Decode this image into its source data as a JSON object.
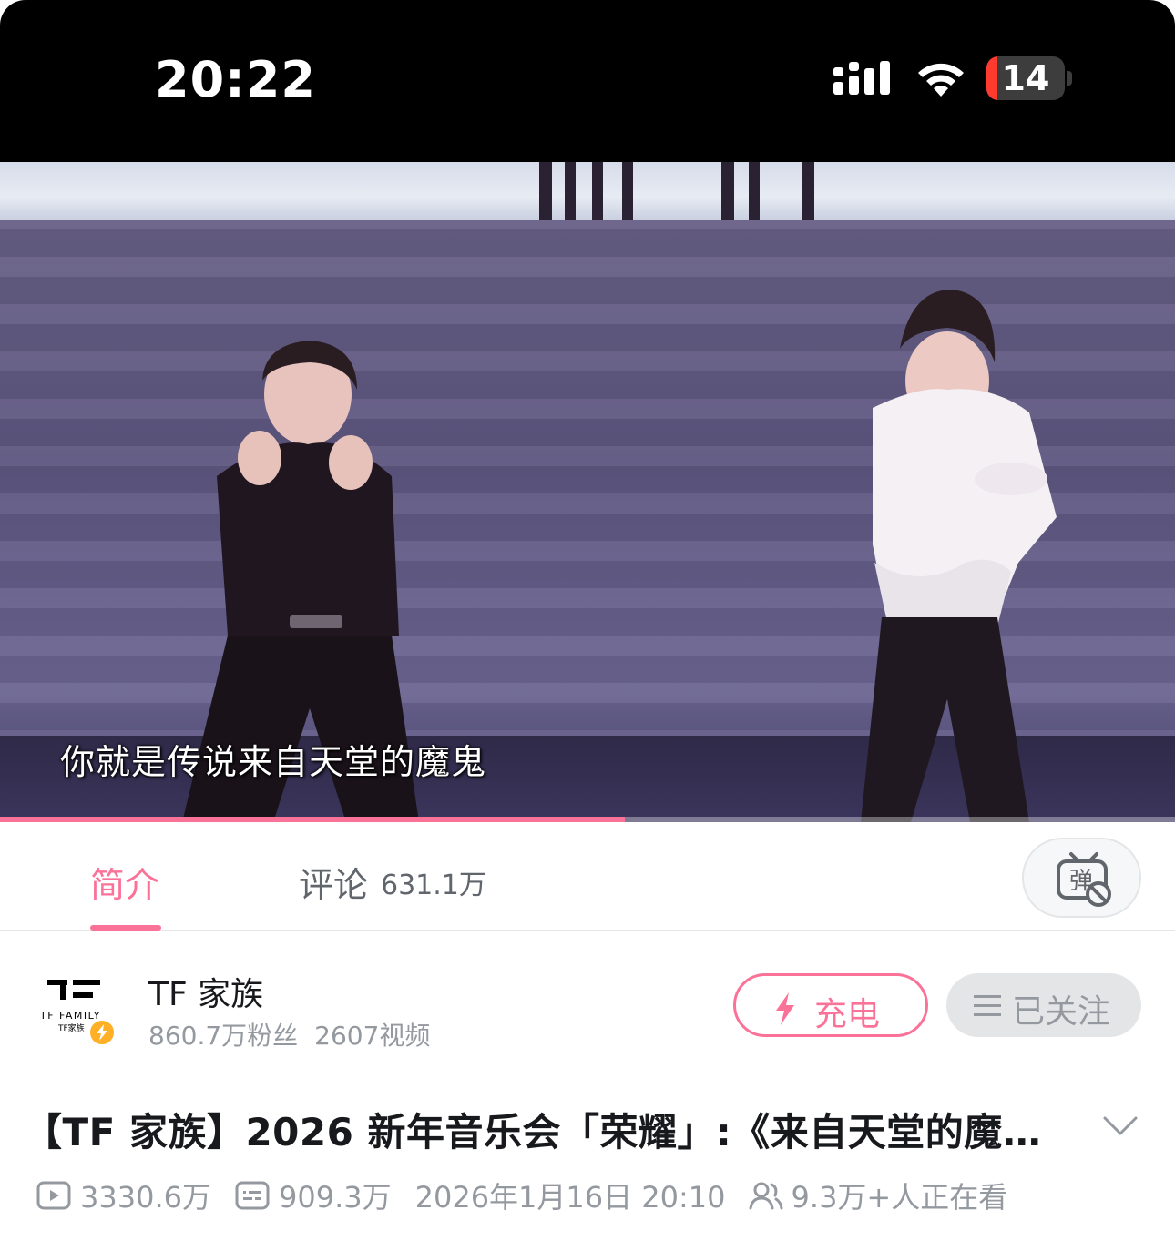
{
  "status_bar": {
    "time": "20:22",
    "battery_level": "14",
    "icons": [
      "signal-icon",
      "wifi-icon",
      "battery-icon"
    ]
  },
  "video": {
    "subtitle": "你就是传说来自天堂的魔鬼",
    "progress_fraction": 0.532,
    "accent_color": "#fb7299"
  },
  "tabs": {
    "intro_label": "简介",
    "comments_label": "评论",
    "comments_count": "631.1万",
    "danmaku_icon": "danmaku-toggle-icon"
  },
  "uploader": {
    "name": "TF 家族",
    "fans": "860.7万粉丝",
    "videos": "2607视频",
    "logo_text": "TF FAMILY",
    "logo_subtext": "TF家族",
    "charge_label": "充电",
    "follow_label": "已关注"
  },
  "title": "【TF 家族】2026 新年音乐会「荣耀」:《来自天堂的魔…",
  "meta": {
    "views": "3330.6万",
    "danmaku": "909.3万",
    "date": "2026年1月16日 20:10",
    "watching": "9.3万+人正在看"
  }
}
